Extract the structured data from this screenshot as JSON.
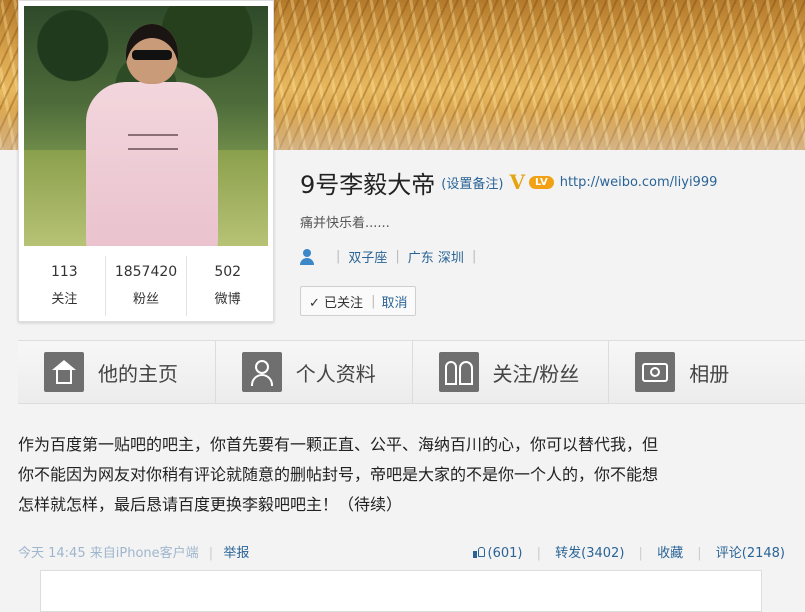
{
  "profile": {
    "name": "9号李毅大帝",
    "remark_link": "(设置备注)",
    "verified_mark": "V",
    "level_badge": "LV",
    "url": "http://weibo.com/liyi999",
    "bio": "痛并快乐着......",
    "zodiac": "双子座",
    "location": "广东 深圳",
    "follow_state": "已关注",
    "follow_checkmark": "✓",
    "cancel_label": "取消",
    "stats": [
      {
        "num": "113",
        "label": "关注"
      },
      {
        "num": "1857420",
        "label": "粉丝"
      },
      {
        "num": "502",
        "label": "微博"
      }
    ]
  },
  "tabs": [
    {
      "label": "他的主页",
      "icon": "home-icon"
    },
    {
      "label": "个人资料",
      "icon": "person-icon"
    },
    {
      "label": "关注/粉丝",
      "icon": "people-icon"
    },
    {
      "label": "相册",
      "icon": "camera-icon"
    }
  ],
  "post": {
    "lines": [
      "作为百度第一贴吧的吧主，你首先要有一颗正直、公平、海纳百川的心，你可以替代我，但",
      "你不能因为网友对你稍有评论就随意的删帖封号，帝吧是大家的不是你一个人的，你不能想",
      "怎样就怎样，最后恳请百度更换李毅吧吧主！（待续）"
    ],
    "time": "今天 14:45",
    "source": "来自iPhone客户端",
    "report": "举报",
    "like": "(601)",
    "repost": "转发(3402)",
    "favorite": "收藏",
    "comment": "评论(2148)"
  },
  "colors": {
    "link": "#2a6496",
    "badge": "#f2a114",
    "verified": "#e5a512"
  }
}
